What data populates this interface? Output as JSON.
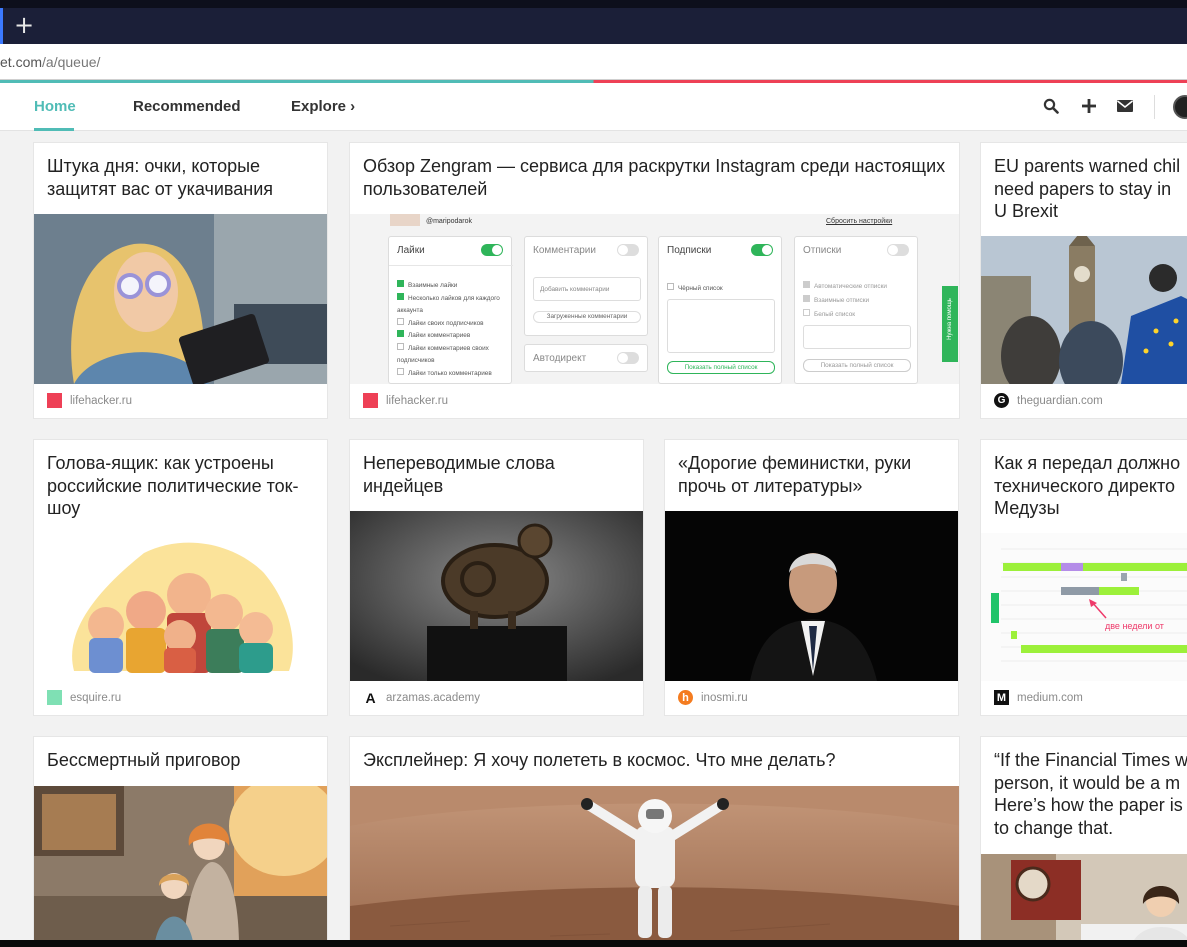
{
  "browser": {
    "new_tab_symbol": "+",
    "url_prefix": "et.com",
    "url_path": "/a/queue/"
  },
  "nav": {
    "home": "Home",
    "recommended": "Recommended",
    "explore": "Explore ›",
    "icons": [
      "search-icon",
      "plus-icon",
      "mail-icon",
      "avatar"
    ]
  },
  "colors": {
    "accent": "#50bcb6",
    "lifehacker": "#ee4056",
    "esquire": "#7fe0b4",
    "inosmi": "#f47c20"
  },
  "cards": [
    {
      "title": "Штука дня: очки, которые защитят вас от укачивания",
      "source": "lifehacker.ru"
    },
    {
      "title": "Обзор Zengram — сервиса для раскрутки Instagram среди настоящих пользователей",
      "source": "lifehacker.ru"
    },
    {
      "title": "EU parents warned chil need papers to stay in U Brexit",
      "source": "theguardian.com"
    },
    {
      "title": "Голова-ящик: как устроены российские политические ток-шоу",
      "source": "esquire.ru"
    },
    {
      "title": "Непереводимые слова индейцев",
      "source": "arzamas.academy"
    },
    {
      "title": "«Дорогие феминистки, руки прочь от литературы»",
      "source": "inosmi.ru"
    },
    {
      "title": "Как я передал должно технического директо Медузы",
      "source": "medium.com"
    },
    {
      "title": "Бессмертный приговор",
      "source": ""
    },
    {
      "title": "Эксплейнер: Я хочу полететь в космос. Что мне делать?",
      "source": ""
    },
    {
      "title": "“If the Financial Times w person, it would be a m Here’s how the paper is to change that.",
      "source": ""
    }
  ],
  "zengram": {
    "user": "@maripodarok",
    "reset": "Сбросить настройки",
    "panels": [
      {
        "title": "Лайки",
        "on": true,
        "items": [
          "Взаимные лайки",
          "Несколько лайков для каждого аккаунта",
          "Лайки своих подписчиков",
          "Лайки комментариев",
          "Лайки комментариев своих подписчиков",
          "Лайки только комментариев"
        ]
      },
      {
        "title": "Комментарии",
        "on": false,
        "items": [
          "Добавить комментарии",
          "Загруженные комментарии"
        ]
      },
      {
        "title": "Подписки",
        "on": true,
        "items": [
          "Чёрный список",
          "Показать полный список"
        ]
      },
      {
        "title": "Отписки",
        "on": false,
        "items": [
          "Автоматические отписки",
          "Взаимные отписки",
          "Белый список",
          "Показать полный список"
        ]
      }
    ],
    "autodirect": "Автодирект",
    "help": "Нужна помощь"
  },
  "medium_chart": {
    "annotation": "две недели от"
  }
}
